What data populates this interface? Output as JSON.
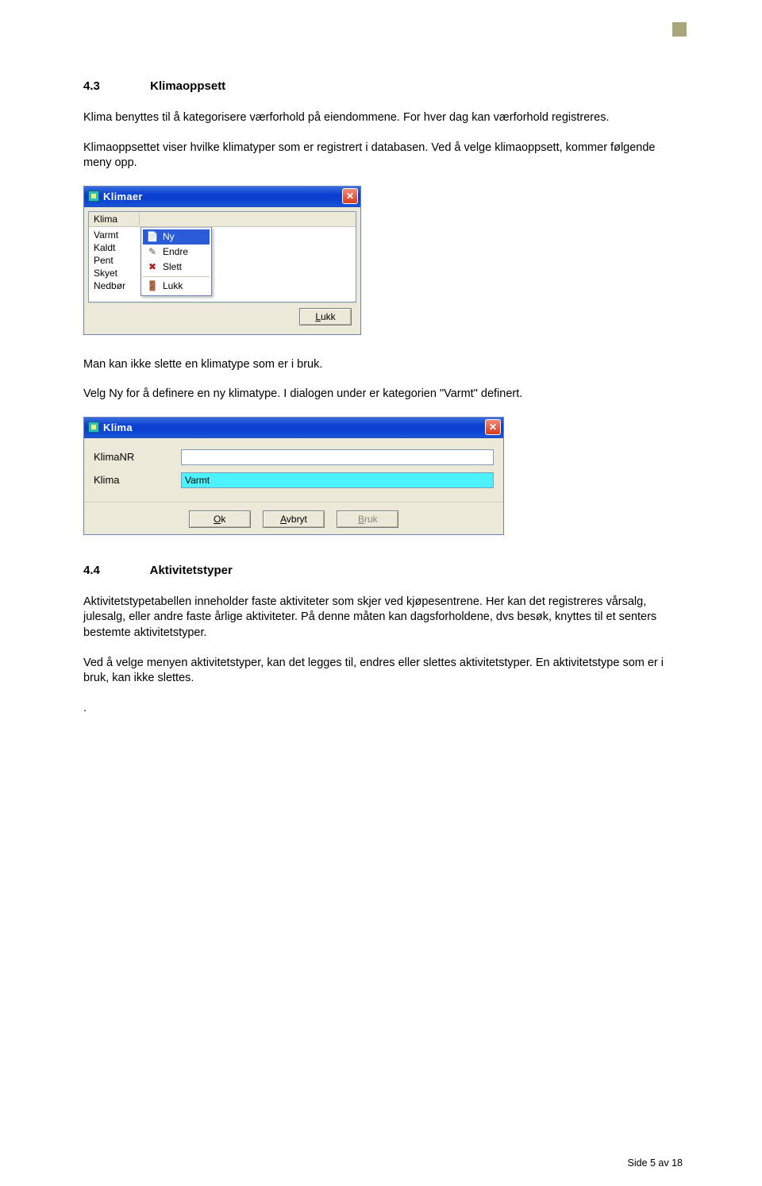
{
  "corner_color": "#a9a67b",
  "section43": {
    "num": "4.3",
    "title": "Klimaoppsett",
    "p1": "Klima benyttes til å kategorisere værforhold på eiendommene. For hver dag kan værforhold registreres.",
    "p2": "Klimaoppsettet viser hvilke klimatyper som er registrert i databasen. Ved å velge klimaoppsett, kommer følgende meny opp.",
    "p3": "Man kan ikke slette en klimatype som er i bruk.",
    "p4": "Velg Ny for å definere en ny klimatype. I dialogen under er kategorien \"Varmt\" definert."
  },
  "win1": {
    "title": "Klimaer",
    "col_header": "Klima",
    "rows": [
      "Varmt",
      "Kaldt",
      "Pent",
      "Skyet",
      "Nedbør"
    ],
    "ctx": {
      "ny": "Ny",
      "endre": "Endre",
      "slett": "Slett",
      "lukk": "Lukk"
    },
    "lukk_btn": "Lukk",
    "lukk_ul": "L"
  },
  "win2": {
    "title": "Klima",
    "label1": "KlimaNR",
    "label2": "Klima",
    "value2": "Varmt",
    "ok": "Ok",
    "ok_ul": "O",
    "avbryt": "Avbryt",
    "avbryt_ul": "A",
    "bruk": "Bruk",
    "bruk_ul": "B"
  },
  "section44": {
    "num": "4.4",
    "title": "Aktivitetstyper",
    "p1": "Aktivitetstypetabellen inneholder faste aktiviteter som skjer ved kjøpesentrene. Her kan det registreres vårsalg, julesalg, eller andre faste årlige aktiviteter. På denne måten kan dagsforholdene, dvs besøk, knyttes til et senters bestemte aktivitetstyper.",
    "p2": "Ved å velge menyen aktivitetstyper, kan det legges til, endres eller slettes aktivitetstyper. En aktivitetstype som er i bruk, kan ikke slettes.",
    "dot": "."
  },
  "footer": "Side 5 av 18"
}
